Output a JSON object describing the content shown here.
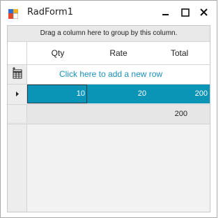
{
  "window": {
    "title": "RadForm1",
    "app_icon": "app-icon",
    "controls": {
      "minimize_icon": "minimize-icon",
      "maximize_icon": "maximize-icon",
      "close_icon": "close-icon"
    }
  },
  "grid": {
    "group_panel_text": "Drag a column here to group by this column.",
    "columns": [
      "Qty",
      "Rate",
      "Total"
    ],
    "new_row_text": "Click here to add a new row",
    "new_row_icon": "new-row-table-icon",
    "rows": [
      {
        "qty": "10",
        "rate": "20",
        "total": "200",
        "selected": true
      }
    ],
    "summary": {
      "total": "200"
    },
    "current_row_indicator_icon": "current-row-arrow-icon",
    "selection_color": "#0a94b5"
  }
}
